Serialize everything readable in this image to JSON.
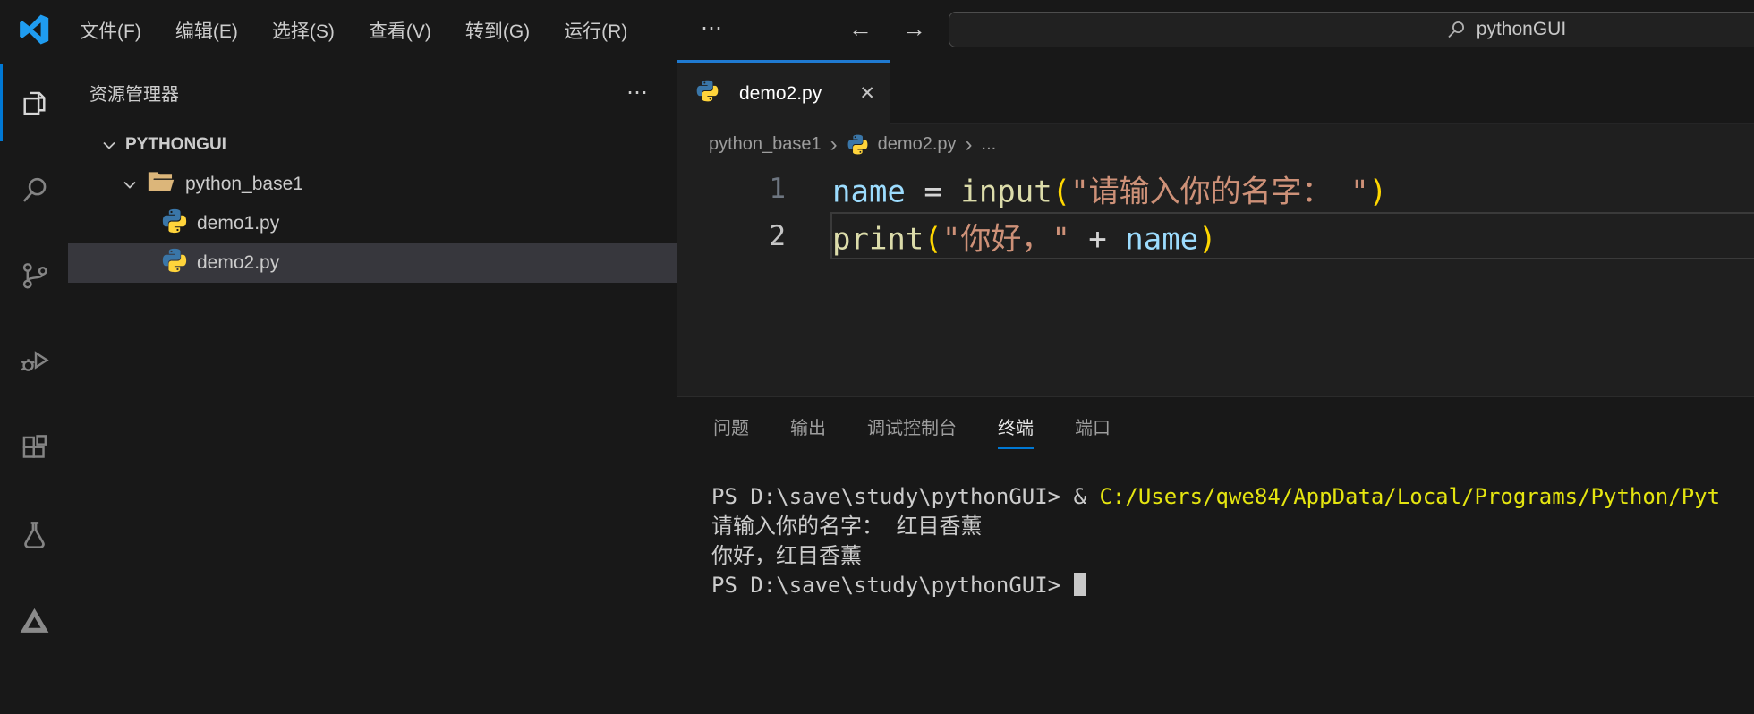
{
  "titlebar": {
    "menus": [
      "文件(F)",
      "编辑(E)",
      "选择(S)",
      "查看(V)",
      "转到(G)",
      "运行(R)"
    ],
    "more_label": "⋯",
    "nav_back": "←",
    "nav_forward": "→",
    "search": {
      "value": "pythonGUI"
    }
  },
  "activity_bar": {
    "items": [
      "explorer",
      "search",
      "source-control",
      "run-and-debug",
      "extensions",
      "testing",
      "extension-knot"
    ]
  },
  "sidebar": {
    "title": "资源管理器",
    "more_label": "⋯",
    "tree": [
      {
        "label": "PYTHONGUI",
        "kind": "root",
        "chevron": true,
        "selected": false
      },
      {
        "label": "python_base1",
        "kind": "folder",
        "chevron": true,
        "icon": "folder-open",
        "selected": false
      },
      {
        "label": "demo1.py",
        "kind": "file",
        "icon": "python",
        "selected": false
      },
      {
        "label": "demo2.py",
        "kind": "file",
        "icon": "python",
        "selected": true
      }
    ]
  },
  "editor": {
    "tab": {
      "label": "demo2.py",
      "icon": "python",
      "close_label": "✕"
    },
    "breadcrumb": [
      {
        "label": "python_base1"
      },
      {
        "label": "demo2.py",
        "icon": "python"
      },
      {
        "label": "..."
      }
    ],
    "code_lines": [
      {
        "number": "1",
        "active": false,
        "tokens": [
          {
            "text": "name",
            "type": "var"
          },
          {
            "text": " ",
            "type": "plain"
          },
          {
            "text": "=",
            "type": "op"
          },
          {
            "text": " ",
            "type": "plain"
          },
          {
            "text": "input",
            "type": "fn"
          },
          {
            "text": "(",
            "type": "br"
          },
          {
            "text": "\"请输入你的名字： \"",
            "type": "str"
          },
          {
            "text": ")",
            "type": "br"
          }
        ]
      },
      {
        "number": "2",
        "active": true,
        "tokens": [
          {
            "text": "print",
            "type": "fn"
          },
          {
            "text": "(",
            "type": "br"
          },
          {
            "text": "\"你好，\"",
            "type": "str"
          },
          {
            "text": " ",
            "type": "plain"
          },
          {
            "text": "+",
            "type": "op"
          },
          {
            "text": " ",
            "type": "plain"
          },
          {
            "text": "name",
            "type": "var"
          },
          {
            "text": ")",
            "type": "br"
          }
        ]
      }
    ]
  },
  "panel": {
    "tabs": [
      {
        "label": "问题",
        "active": false
      },
      {
        "label": "输出",
        "active": false
      },
      {
        "label": "调试控制台",
        "active": false
      },
      {
        "label": "终端",
        "active": true
      },
      {
        "label": "端口",
        "active": false
      }
    ],
    "terminal": {
      "lines": [
        {
          "cursor": false,
          "segments": [
            {
              "text": "PS D:\\save\\study\\pythonGUI> & ",
              "color": "fg"
            },
            {
              "text": "C:/Users/qwe84/AppData/Local/Programs/Python/Pyt",
              "color": "yellow"
            }
          ]
        },
        {
          "cursor": false,
          "segments": [
            {
              "text": "请输入你的名字： 红目香薰",
              "color": "fg"
            }
          ]
        },
        {
          "cursor": false,
          "segments": [
            {
              "text": "你好，红目香薰",
              "color": "fg"
            }
          ]
        },
        {
          "cursor": true,
          "segments": [
            {
              "text": "PS D:\\save\\study\\pythonGUI> ",
              "color": "fg"
            }
          ]
        }
      ]
    }
  },
  "colors": {
    "accent": "#0078d4",
    "selection_bg": "#37373d",
    "string": "#ce9178",
    "function": "#dcdcaa",
    "variable": "#9cdcfe",
    "bracket": "#ffd700",
    "terminal_yellow": "#e5e510"
  }
}
